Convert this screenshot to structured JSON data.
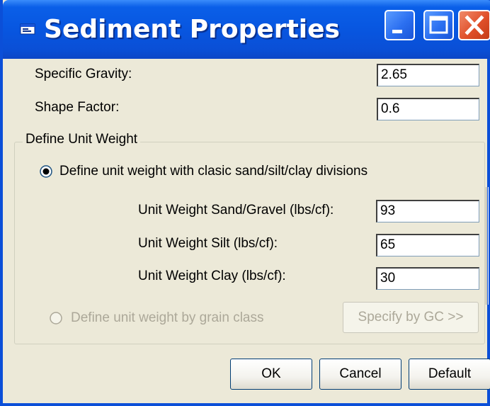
{
  "window": {
    "title": "Sediment Properties",
    "controls": {
      "minimize": "minimize-icon",
      "maximize": "maximize-icon",
      "close": "close-icon"
    }
  },
  "fields": {
    "specific_gravity": {
      "label": "Specific Gravity:",
      "value": "2.65"
    },
    "shape_factor": {
      "label": "Shape Factor:",
      "value": "0.6"
    }
  },
  "unit_weight_group": {
    "legend": "Define Unit Weight",
    "option_classic": {
      "label": "Define unit weight with clasic sand/silt/clay divisions",
      "selected": true
    },
    "sand_gravel": {
      "label": "Unit Weight Sand/Gravel (lbs/cf):",
      "value": "93"
    },
    "silt": {
      "label": "Unit Weight Silt (lbs/cf):",
      "value": "65"
    },
    "clay": {
      "label": "Unit Weight Clay (lbs/cf):",
      "value": "30"
    },
    "option_grain_class": {
      "label": "Define unit weight by grain class",
      "selected": false,
      "enabled": false
    },
    "specify_button": {
      "label": "Specify by GC >>",
      "enabled": false
    }
  },
  "buttons": {
    "ok": "OK",
    "cancel": "Cancel",
    "default": "Default"
  },
  "colors": {
    "titlebar": "#0856e0",
    "face": "#ece9d8",
    "disabled_text": "#aca899",
    "close_button": "#e0502a"
  }
}
